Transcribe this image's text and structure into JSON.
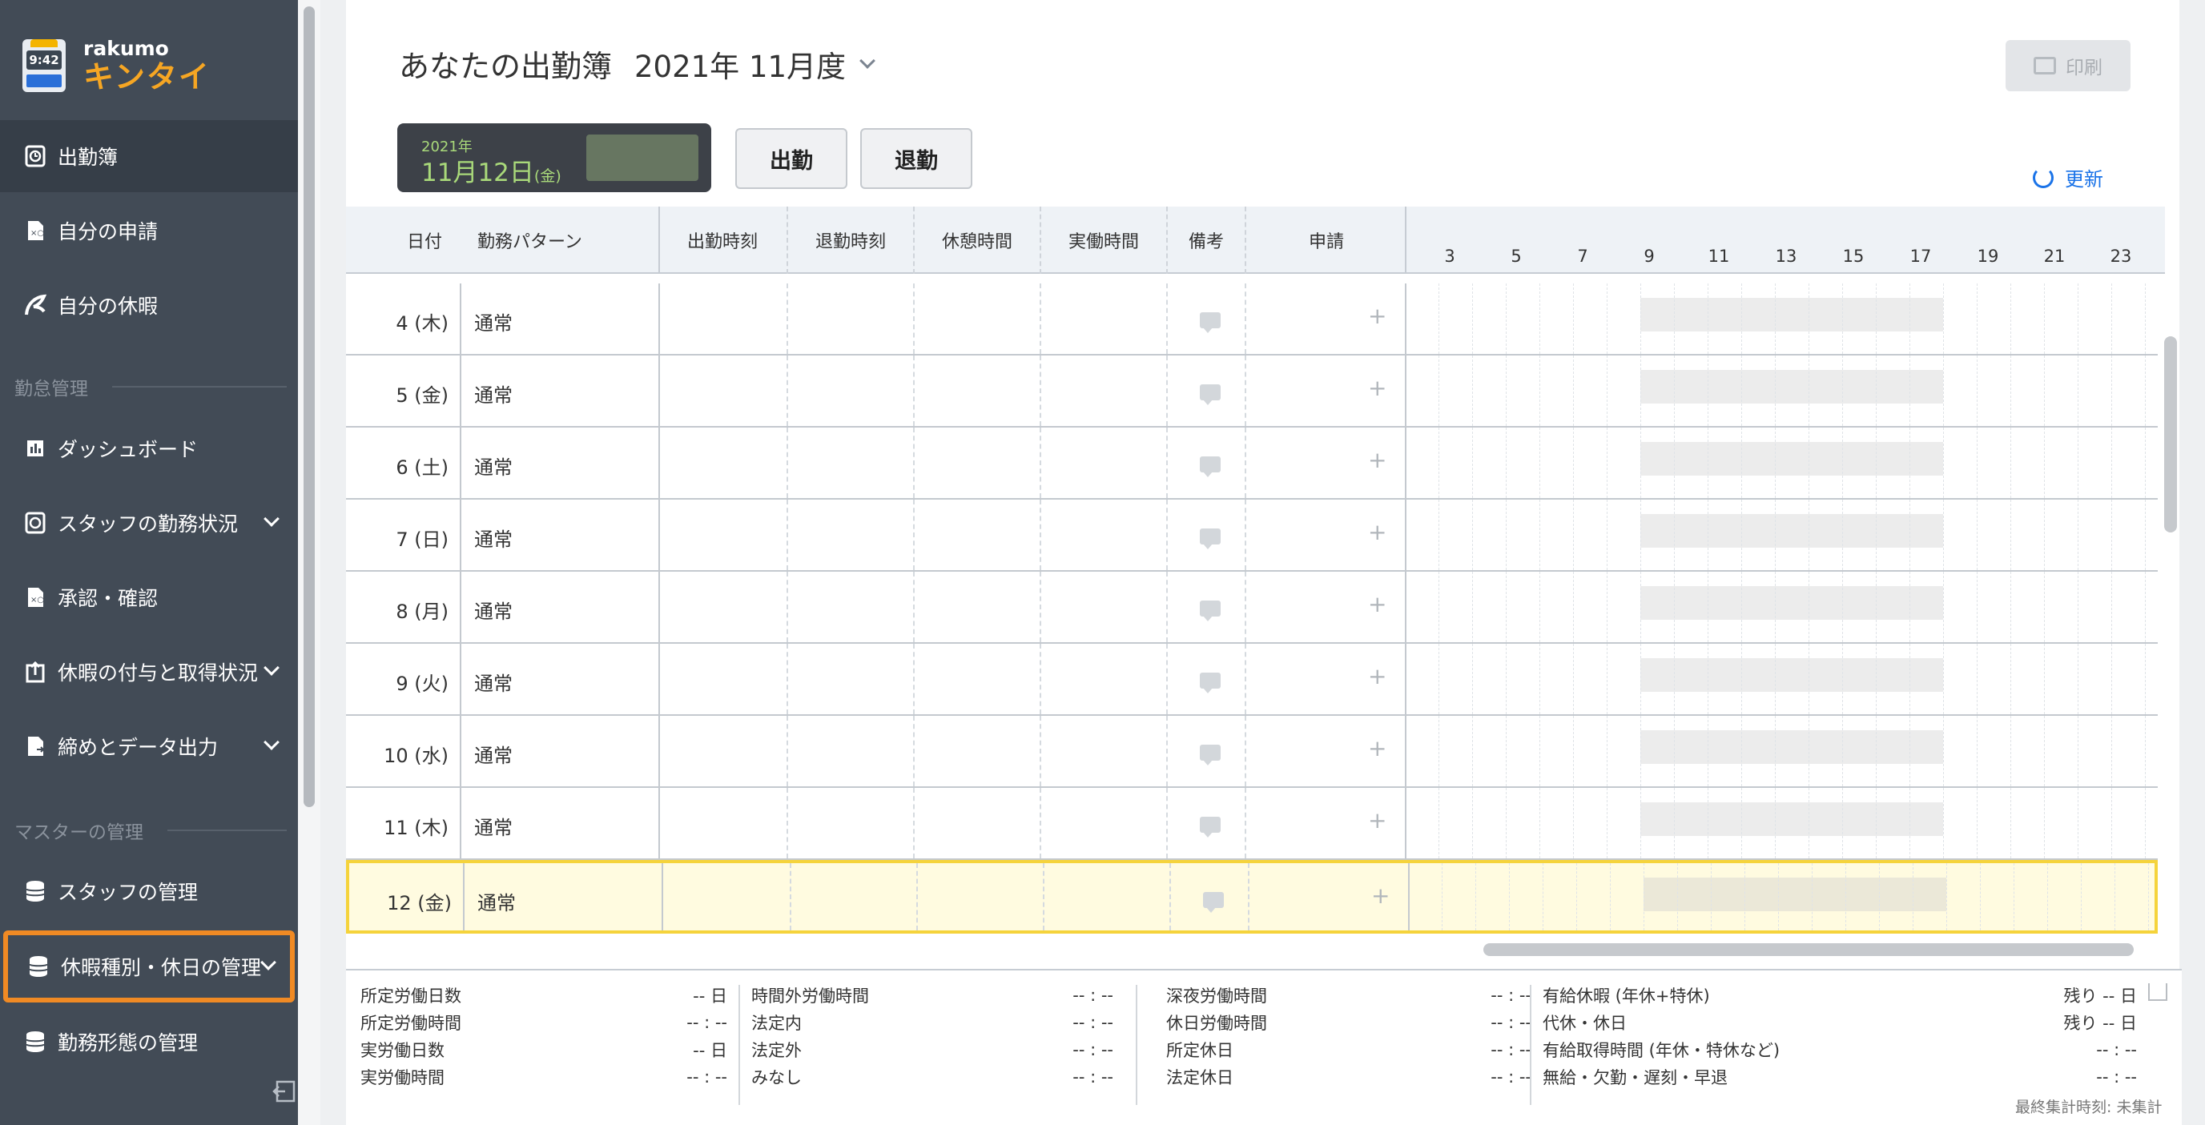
{
  "app": {
    "brand_en": "rakumo",
    "brand_jp": "キンタイ",
    "clock": "9:42"
  },
  "sidebar": {
    "items": [
      {
        "label": "出勤簿",
        "icon": "attendance-clock-icon"
      },
      {
        "label": "自分の申請",
        "icon": "application-doc-icon"
      },
      {
        "label": "自分の休暇",
        "icon": "leave-icon"
      },
      {
        "label": "ダッシュボード",
        "icon": "dashboard-chart-icon"
      },
      {
        "label": "スタッフの勤務状況",
        "icon": "staff-status-icon"
      },
      {
        "label": "承認・確認",
        "icon": "approval-icon"
      },
      {
        "label": "休暇の付与と取得状況",
        "icon": "leave-grant-icon"
      },
      {
        "label": "締めとデータ出力",
        "icon": "export-doc-icon"
      },
      {
        "label": "スタッフの管理",
        "icon": "staff-db-icon"
      },
      {
        "label": "休暇種別・休日の管理",
        "icon": "leave-type-db-icon"
      },
      {
        "label": "勤務形態の管理",
        "icon": "work-pattern-db-icon"
      }
    ],
    "sections": {
      "attendance": "勤怠管理",
      "master": "マスターの管理"
    }
  },
  "header": {
    "title": "あなたの出勤簿",
    "month": "2021年 11月度",
    "print_label": "印刷",
    "refresh_label": "更新"
  },
  "today": {
    "year": "2021年",
    "month_day": "11月12日",
    "weekday": "(金)"
  },
  "actions": {
    "clock_in": "出勤",
    "clock_out": "退勤"
  },
  "table": {
    "headers": [
      "日付",
      "勤務パターン",
      "出勤時刻",
      "退勤時刻",
      "休憩時間",
      "実働時間",
      "備考",
      "申請"
    ],
    "hours": [
      "3",
      "5",
      "7",
      "9",
      "11",
      "13",
      "15",
      "17",
      "19",
      "21",
      "23"
    ],
    "rows": [
      {
        "date": "4 (木)",
        "pattern": "通常"
      },
      {
        "date": "5 (金)",
        "pattern": "通常"
      },
      {
        "date": "6 (土)",
        "pattern": "通常"
      },
      {
        "date": "7 (日)",
        "pattern": "通常"
      },
      {
        "date": "8 (月)",
        "pattern": "通常"
      },
      {
        "date": "9 (火)",
        "pattern": "通常"
      },
      {
        "date": "10 (水)",
        "pattern": "通常"
      },
      {
        "date": "11 (木)",
        "pattern": "通常"
      },
      {
        "date": "12 (金)",
        "pattern": "通常"
      }
    ],
    "add_symbol": "+"
  },
  "summary": {
    "col1": [
      {
        "label": "所定労働日数",
        "value": "-- 日"
      },
      {
        "label": "所定労働時間",
        "value": "-- : --"
      },
      {
        "label": "実労働日数",
        "value": "-- 日"
      },
      {
        "label": "実労働時間",
        "value": "-- : --"
      }
    ],
    "col2": [
      {
        "label": "時間外労働時間",
        "value": "-- : --"
      },
      {
        "label": "法定内",
        "value": "-- : --"
      },
      {
        "label": "法定外",
        "value": "-- : --"
      },
      {
        "label": "みなし",
        "value": "-- : --"
      }
    ],
    "col3": [
      {
        "label": "深夜労働時間",
        "value": "-- : --"
      },
      {
        "label": "休日労働時間",
        "value": "-- : --"
      },
      {
        "label": "所定休日",
        "value": "-- : --"
      },
      {
        "label": "法定休日",
        "value": "-- : --"
      }
    ],
    "col4": [
      {
        "label": "有給休暇 (年休+特休)",
        "value": "残り -- 日"
      },
      {
        "label": "代休・休日",
        "value": "残り -- 日"
      },
      {
        "label": "有給取得時間 (年休・特休など)",
        "value": "-- : --"
      },
      {
        "label": "無給・欠勤・遅刻・早退",
        "value": "-- : --"
      }
    ],
    "footer": "最終集計時刻: 未集計"
  }
}
